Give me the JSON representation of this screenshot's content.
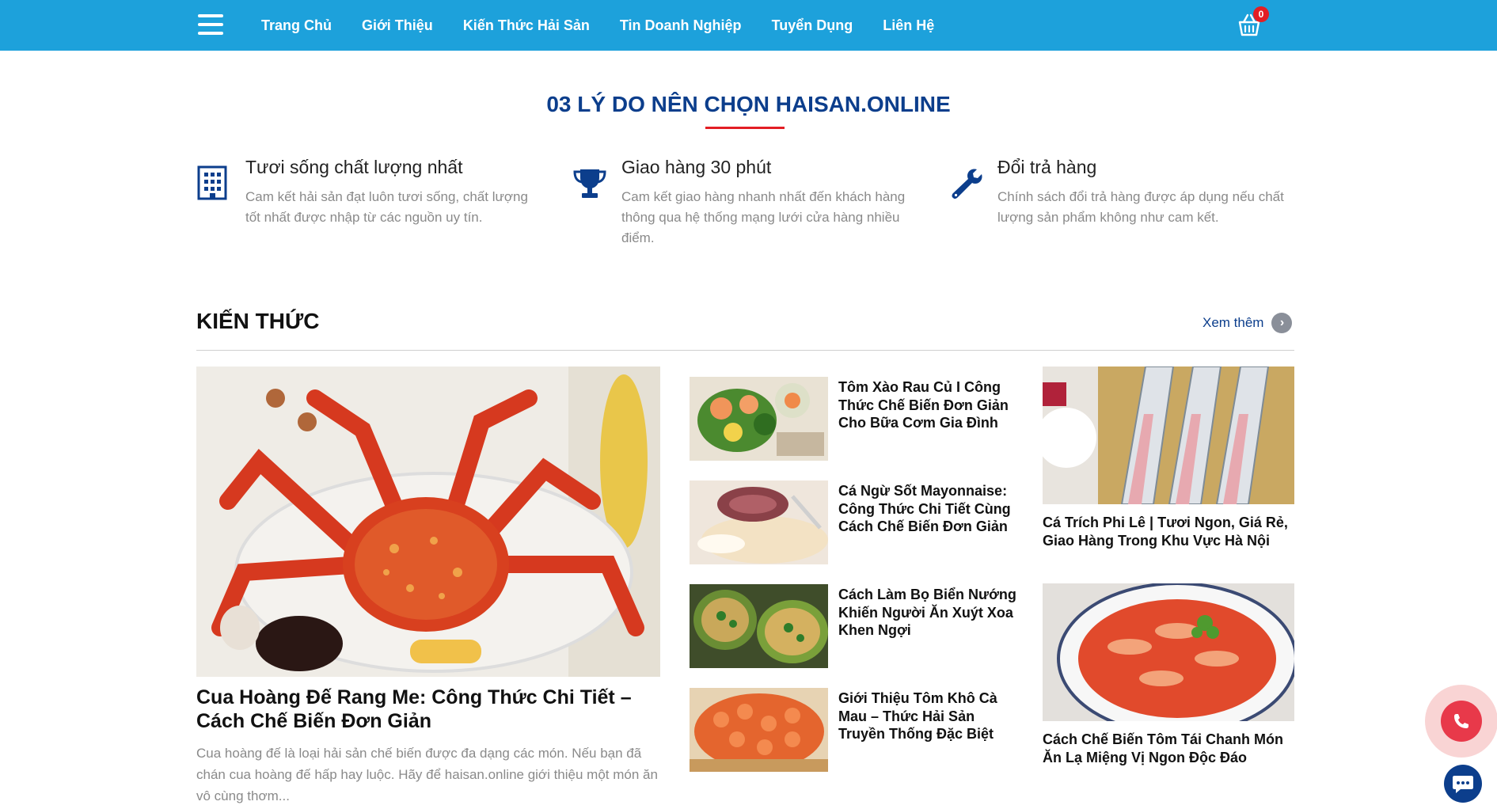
{
  "header": {
    "menu_icon": "hamburger-menu-icon",
    "nav": [
      "Trang Chủ",
      "Giới Thiệu",
      "Kiến Thức Hải Sản",
      "Tin Doanh Nghiệp",
      "Tuyển Dụng",
      "Liên Hệ"
    ],
    "cart_icon": "shopping-basket-icon",
    "cart_count": "0",
    "bg_color": "#1da1db"
  },
  "reasons": {
    "title": "03 LÝ DO NÊN CHỌN HAISAN.ONLINE",
    "items": [
      {
        "icon": "building-icon",
        "title": "Tươi sống chất lượng nhất",
        "desc": "Cam kết hải sản đạt luôn tươi sống, chất lượng tốt nhất được nhập từ các nguồn uy tín."
      },
      {
        "icon": "trophy-icon",
        "title": "Giao hàng 30 phút",
        "desc": "Cam kết giao hàng nhanh nhất đến khách hàng thông qua hệ thống mạng lưới cửa hàng nhiều điểm."
      },
      {
        "icon": "wrench-icon",
        "title": "Đổi trả hàng",
        "desc": "Chính sách đổi trả hàng được áp dụng nếu chất lượng sản phẩm không như cam kết."
      }
    ]
  },
  "knowledge": {
    "title": "KIẾN THỨC",
    "see_more": "Xem thêm",
    "feature": {
      "title": "Cua Hoàng Đế Rang Me: Công Thức Chi Tiết – Cách Chế Biến Đơn Giản",
      "desc": "Cua hoàng đế là loại hải sản chế biến được đa dạng các món. Nếu bạn đã chán cua hoàng đế hấp hay luộc. Hãy để haisan.online giới thiệu một món ăn vô cùng thơm..."
    },
    "list": [
      {
        "title": "Tôm Xào Rau Củ I Công Thức Chế Biến Đơn Giản Cho Bữa Cơm Gia Đình"
      },
      {
        "title": "Cá Ngừ Sốt Mayonnaise: Công Thức Chi Tiết Cùng Cách Chế Biến Đơn Giản"
      },
      {
        "title": "Cách Làm Bọ Biển Nướng Khiến Người Ăn Xuýt Xoa Khen Ngợi"
      },
      {
        "title": "Giới Thiệu Tôm Khô Cà Mau – Thức Hải Sản Truyền Thống Đặc Biệt"
      }
    ],
    "side": [
      {
        "title": "Cá Trích Phi Lê | Tươi Ngon, Giá Rẻ, Giao Hàng Trong Khu Vực Hà Nội"
      },
      {
        "title": "Cách Chế Biến Tôm Tái Chanh Món Ăn Lạ Miệng Vị Ngon Độc Đáo"
      }
    ]
  },
  "floating": {
    "phone_icon": "phone-icon",
    "chat_icon": "chat-bubble-icon"
  }
}
